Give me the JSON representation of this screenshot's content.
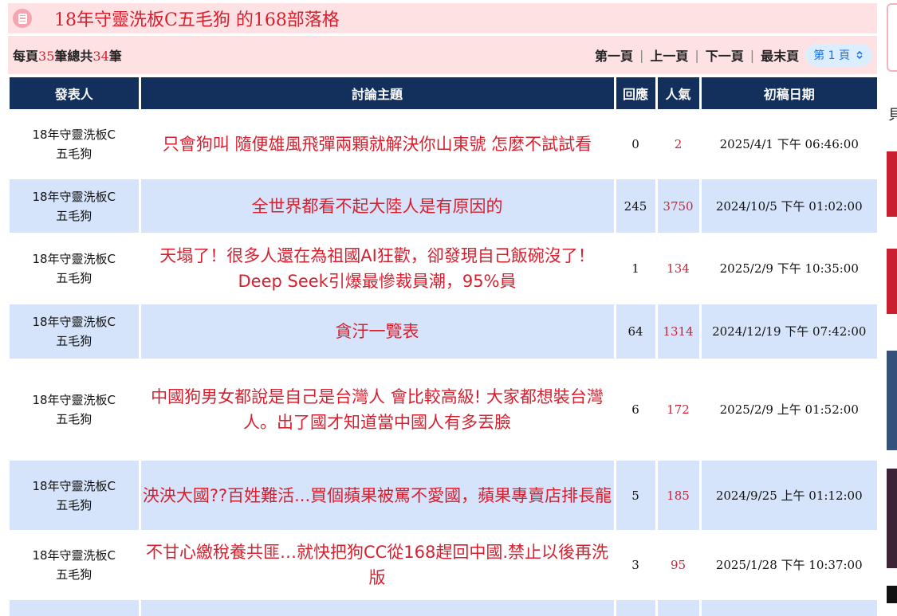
{
  "header": {
    "title": "18年守靈洗板C五毛狗 的168部落格"
  },
  "pager": {
    "per_page_prefix": "每頁",
    "per_page_count": "35",
    "total_prefix": "筆總共",
    "total_count": "34",
    "total_suffix": "筆",
    "first": "第一頁",
    "prev": "上一頁",
    "next": "下一頁",
    "last": "最末頁",
    "page_select": "第 1 頁",
    "separator": "|"
  },
  "table": {
    "columns": [
      "發表人",
      "討論主題",
      "回應",
      "人氣",
      "初稿日期"
    ],
    "rows": [
      {
        "poster_line1": "18年守靈洗板C",
        "poster_line2": "五毛狗",
        "subject": "只會狗叫 隨便雄風飛彈兩顆就解決你山東號 怎麼不試試看",
        "replies": "0",
        "hits": "2",
        "date": "2025/4/1 下午 06:46:00"
      },
      {
        "poster_line1": "18年守靈洗板C",
        "poster_line2": "五毛狗",
        "subject": "全世界都看不起大陸人是有原因的",
        "replies": "245",
        "hits": "3750",
        "date": "2024/10/5 下午 01:02:00"
      },
      {
        "poster_line1": "18年守靈洗板C",
        "poster_line2": "五毛狗",
        "subject": "天塌了！很多人還在為祖國AI狂歡，卻發現自己飯碗沒了！Deep Seek引爆最慘裁員潮，95%員",
        "replies": "1",
        "hits": "134",
        "date": "2025/2/9 下午 10:35:00"
      },
      {
        "poster_line1": "18年守靈洗板C",
        "poster_line2": "五毛狗",
        "subject": "貪汙一覽表",
        "replies": "64",
        "hits": "1314",
        "date": "2024/12/19 下午 07:42:00"
      },
      {
        "poster_line1": "18年守靈洗板C",
        "poster_line2": "五毛狗",
        "subject": "中國狗男女都說是自己是台灣人 會比較高級! 大家都想裝台灣人。出了國才知道當中國人有多丟臉",
        "replies": "6",
        "hits": "172",
        "date": "2025/2/9 上午 01:52:00"
      },
      {
        "poster_line1": "18年守靈洗板C",
        "poster_line2": "五毛狗",
        "subject": "泱泱大國??百姓難活...買個蘋果被罵不愛國，蘋果專賣店排長龍",
        "replies": "5",
        "hits": "185",
        "date": "2024/9/25 上午 01:12:00"
      },
      {
        "poster_line1": "18年守靈洗板C",
        "poster_line2": "五毛狗",
        "subject": "不甘心繳稅養共匪…就快把狗CC從168趕回中國.禁止以後再洗版",
        "replies": "3",
        "hits": "95",
        "date": "2025/1/28 下午 10:37:00"
      }
    ]
  },
  "right_strip": {
    "glyph": "貝"
  },
  "colors": {
    "accent_red": "#d6202f",
    "header_navy": "#13305c",
    "row_blue": "#d6e4fb",
    "pink_bg": "#fde1e3"
  }
}
